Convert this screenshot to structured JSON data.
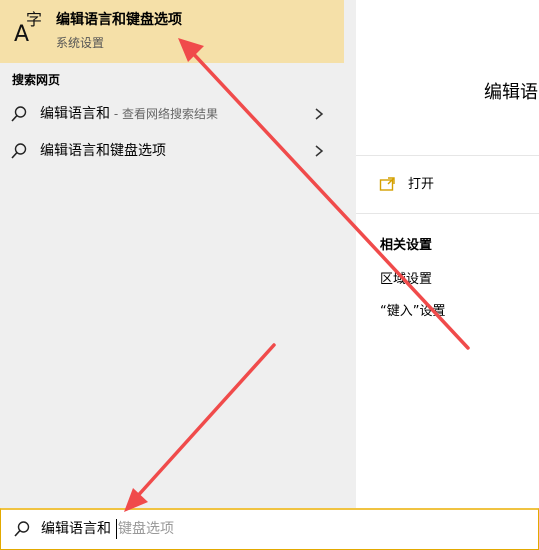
{
  "best_match": {
    "icon_text_a": "A",
    "icon_text_zi": "字",
    "title": "编辑语言和键盘选项",
    "subtitle": "系统设置"
  },
  "web_section": {
    "heading": "搜索网页",
    "items": [
      {
        "main": "编辑语言和",
        "suffix": " - 查看网络搜索结果"
      },
      {
        "main": "编辑语言和键盘选项",
        "suffix": ""
      }
    ]
  },
  "detail": {
    "title": "编辑语言",
    "open_label": "打开",
    "related_heading": "相关设置",
    "related_items": [
      "区域设置",
      "“键入”设置"
    ]
  },
  "searchbar": {
    "typed": "编辑语言和",
    "hint": "键盘选项"
  },
  "colors": {
    "highlight": "#f5e0a8",
    "arrow": "#f04b4b",
    "accent": "#e2a900"
  },
  "icons": {
    "search": "magnifier-icon",
    "chevron": "chevron-right-icon",
    "open": "open-icon"
  }
}
